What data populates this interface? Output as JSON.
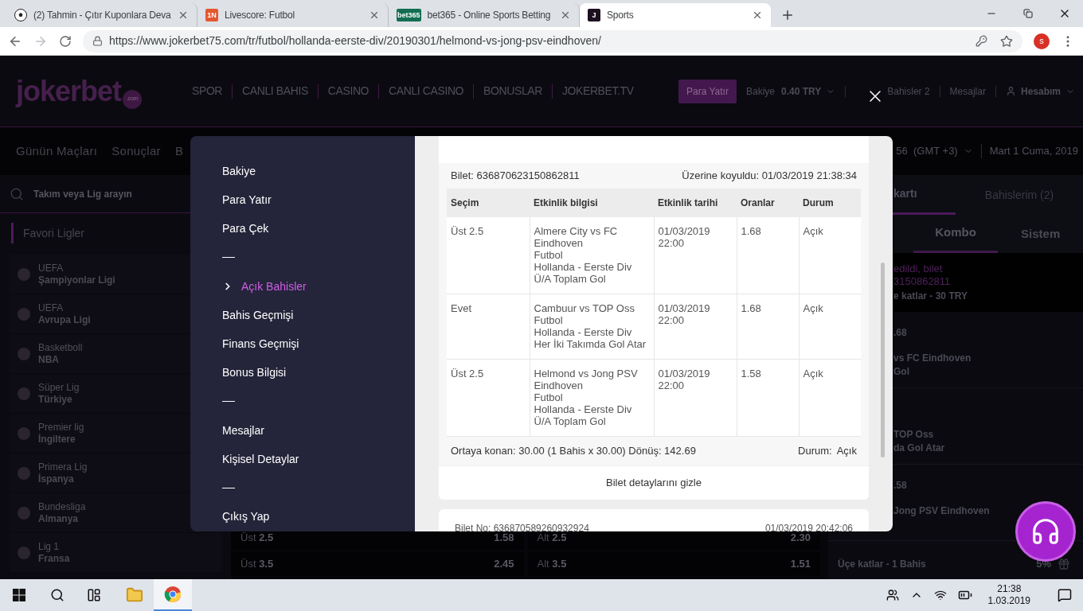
{
  "browser": {
    "tabs": [
      {
        "title": "(2) Tahmin - Çıtır Kuponlara Deva",
        "kind": "ball",
        "selected": false
      },
      {
        "title": "Livescore: Futbol",
        "kind": "text",
        "favicon_text": "1N",
        "color": "#e4572e",
        "selected": false
      },
      {
        "title": "bet365 - Online Sports Betting",
        "kind": "text",
        "favicon_text": "bet365",
        "color": "#126e51",
        "selected": false
      },
      {
        "title": "Sports",
        "kind": "text",
        "favicon_text": "J",
        "color": "#1c1020",
        "selected": true
      }
    ],
    "url": "https://www.jokerbet75.com/tr/futbol/hollanda-eerste-div/20190301/helmond-vs-jong-psv-eindhoven/",
    "profile": "s"
  },
  "header": {
    "logo": "jokerbet",
    "logo_suffix": ".com",
    "nav": [
      "SPOR",
      "CANLI BAHIS",
      "CASINO",
      "CANLI CASINO",
      "BONUSLAR",
      "JOKERBET.TV"
    ],
    "deposit_button": "Para Yatır",
    "balance_label": "Bakiye",
    "balance": "0.40 TRY",
    "bets": "Bahisler 2",
    "messages": "Mesajlar",
    "account": "Hesabım"
  },
  "subnav": {
    "items": [
      "Günün Maçları",
      "Sonuçlar",
      "B"
    ],
    "time": "56  (GMT +3)",
    "date": "Mart 1 Cuma, 2019"
  },
  "sidebar": {
    "search_placeholder": "Takım veya Lig arayın",
    "favorites_title": "Favori Ligler",
    "leagues": [
      {
        "region": "UEFA",
        "name": "Şampiyonlar Ligi"
      },
      {
        "region": "UEFA",
        "name": "Avrupa Ligi"
      },
      {
        "region": "Basketboll",
        "name": "NBA"
      },
      {
        "region": "Süper Lig",
        "name": "Türkiye"
      },
      {
        "region": "Premier lig",
        "name": "İngiltere"
      },
      {
        "region": "Primera Lig",
        "name": "İspanya"
      },
      {
        "region": "Bundesliga",
        "name": "Almanya"
      },
      {
        "region": "Lig 1",
        "name": "Fransa"
      }
    ]
  },
  "odds_rows": [
    [
      {
        "label": "Üst",
        "line": "2.5",
        "odds": "1.58"
      },
      {
        "label": "Alt",
        "line": "2.5",
        "odds": "2.30"
      }
    ],
    [
      {
        "label": "Üst",
        "line": "3.5",
        "odds": "2.45"
      },
      {
        "label": "Alt",
        "line": "3.5",
        "odds": "1.51"
      }
    ]
  ],
  "betslip": {
    "tabs": [
      {
        "label": "kartı",
        "selected": true
      },
      {
        "label": "Bahislerim (2)",
        "selected": false
      }
    ],
    "subtabs": [
      {
        "label": "Kombo",
        "selected": true
      },
      {
        "label": "Sistem",
        "selected": false
      }
    ],
    "notice": {
      "lines": [
        "edildi, bilet",
        "3150862811"
      ],
      "detail": "e katlar - 30 TRY"
    },
    "selections": [
      {
        "odds": ".68",
        "event": "vs FC Eindhoven",
        "market": "Gol"
      },
      {
        "event": "TOP Oss",
        "market": "da Gol Atar"
      },
      {
        "odds": ".58",
        "event": "Jong PSV Eindhoven"
      }
    ],
    "footer": {
      "label": "Üçe katlar - 1 Bahis",
      "bonus": "5%"
    }
  },
  "modal": {
    "menu": [
      {
        "kind": "link",
        "label": "Bakiye",
        "selected": false
      },
      {
        "kind": "link",
        "label": "Para Yatır",
        "selected": false
      },
      {
        "kind": "link",
        "label": "Para Çek",
        "selected": false
      },
      {
        "kind": "divider"
      },
      {
        "kind": "link",
        "label": "Açık Bahisler",
        "selected": true
      },
      {
        "kind": "link",
        "label": "Bahis Geçmişi",
        "selected": false
      },
      {
        "kind": "link",
        "label": "Finans Geçmişi",
        "selected": false
      },
      {
        "kind": "link",
        "label": "Bonus Bilgisi",
        "selected": false
      },
      {
        "kind": "divider"
      },
      {
        "kind": "link",
        "label": "Mesajlar",
        "selected": false
      },
      {
        "kind": "link",
        "label": "Kişisel Detaylar",
        "selected": false
      },
      {
        "kind": "divider"
      },
      {
        "kind": "link",
        "label": "Çıkış Yap",
        "selected": false
      }
    ],
    "ticket": {
      "number": "Bilet: 636870623150862811",
      "placed": "Üzerine koyuldu: 01/03/2019 21:38:34",
      "columns": [
        "Seçim",
        "Etkinlik bilgisi",
        "Etkinlik tarihi",
        "Oranlar",
        "Durum"
      ],
      "rows": [
        {
          "selection": "Üst 2.5",
          "event": [
            "Almere City vs FC Eindhoven",
            "Futbol",
            "Hollanda - Eerste Div",
            "Ü/A Toplam Gol"
          ],
          "date": "01/03/2019 22:00",
          "odds": "1.68",
          "status": "Açık"
        },
        {
          "selection": "Evet",
          "event": [
            "Cambuur vs TOP Oss",
            "Futbol",
            "Hollanda - Eerste Div",
            "Her İki Takımda Gol Atar"
          ],
          "date": "01/03/2019 22:00",
          "odds": "1.68",
          "status": "Açık"
        },
        {
          "selection": "Üst 2.5",
          "event": [
            "Helmond vs Jong PSV Eindhoven",
            "Futbol",
            "Hollanda - Eerste Div",
            "Ü/A Toplam Gol"
          ],
          "date": "01/03/2019 22:00",
          "odds": "1.58",
          "status": "Açık"
        }
      ],
      "summary": "Ortaya konan: 30.00 (1 Bahis x 30.00) Dönüş: 142.69",
      "status_label": "Durum:",
      "status": "Açık",
      "toggle": "Bilet detaylarını gizle"
    },
    "next_ticket": {
      "number": "Bilet No: 636870589260932924",
      "date": "01/03/2019 20:42:06"
    }
  },
  "taskbar": {
    "apps": [
      {
        "kind": "explorer",
        "selected": false
      },
      {
        "kind": "chrome",
        "selected": true
      }
    ],
    "time": "21:38",
    "date": "1.03.2019"
  }
}
